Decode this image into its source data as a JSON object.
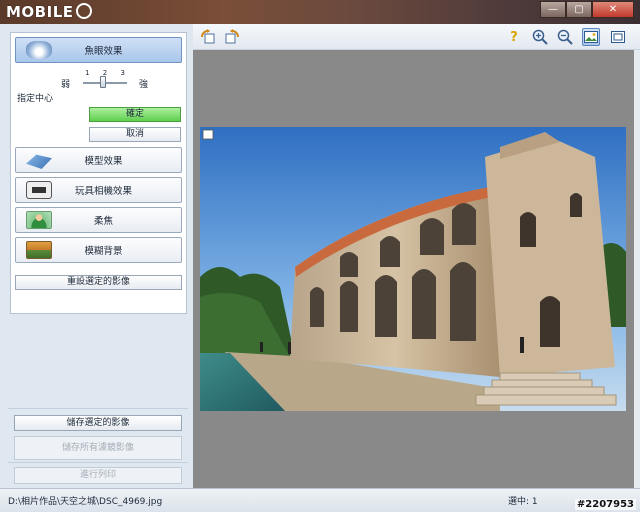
{
  "title": {
    "logo_text": "MOBILE",
    "logo_mark": "01"
  },
  "window_buttons": {
    "minimize": "—",
    "maximize": "▢",
    "close": "✕"
  },
  "effects": {
    "fisheye": "魚眼效果",
    "miniature": "模型效果",
    "toy_camera": "玩具相機效果",
    "soft_focus": "柔焦",
    "blur_background": "模糊背景"
  },
  "fisheye_options": {
    "weak": "弱",
    "strong": "強",
    "ticks": [
      "1",
      "2",
      "3"
    ],
    "level": 2,
    "specify_center": "指定中心",
    "ok": "確定",
    "cancel": "取消"
  },
  "reset": "重設選定的影像",
  "save_selected": "儲存選定的影像",
  "save_all": "儲存所有濾鏡影像",
  "print": "進行列印",
  "status": {
    "path": "D:\\相片作品\\天空之城\\DSC_4969.jpg",
    "selected": "選中: 1",
    "watermark": "#2207953"
  },
  "icons": {
    "fisheye": "fisheye-icon",
    "miniature": "miniature-icon",
    "toy_camera": "camera-icon",
    "soft_focus": "portrait-icon",
    "blur_background": "landscape-icon",
    "rotate_left": "rotate-left-icon",
    "rotate_right": "rotate-right-icon",
    "help": "help-icon",
    "zoom_in": "zoom-in-icon",
    "zoom_out": "zoom-out-icon",
    "fit": "fit-window-icon",
    "actual": "actual-size-icon"
  }
}
